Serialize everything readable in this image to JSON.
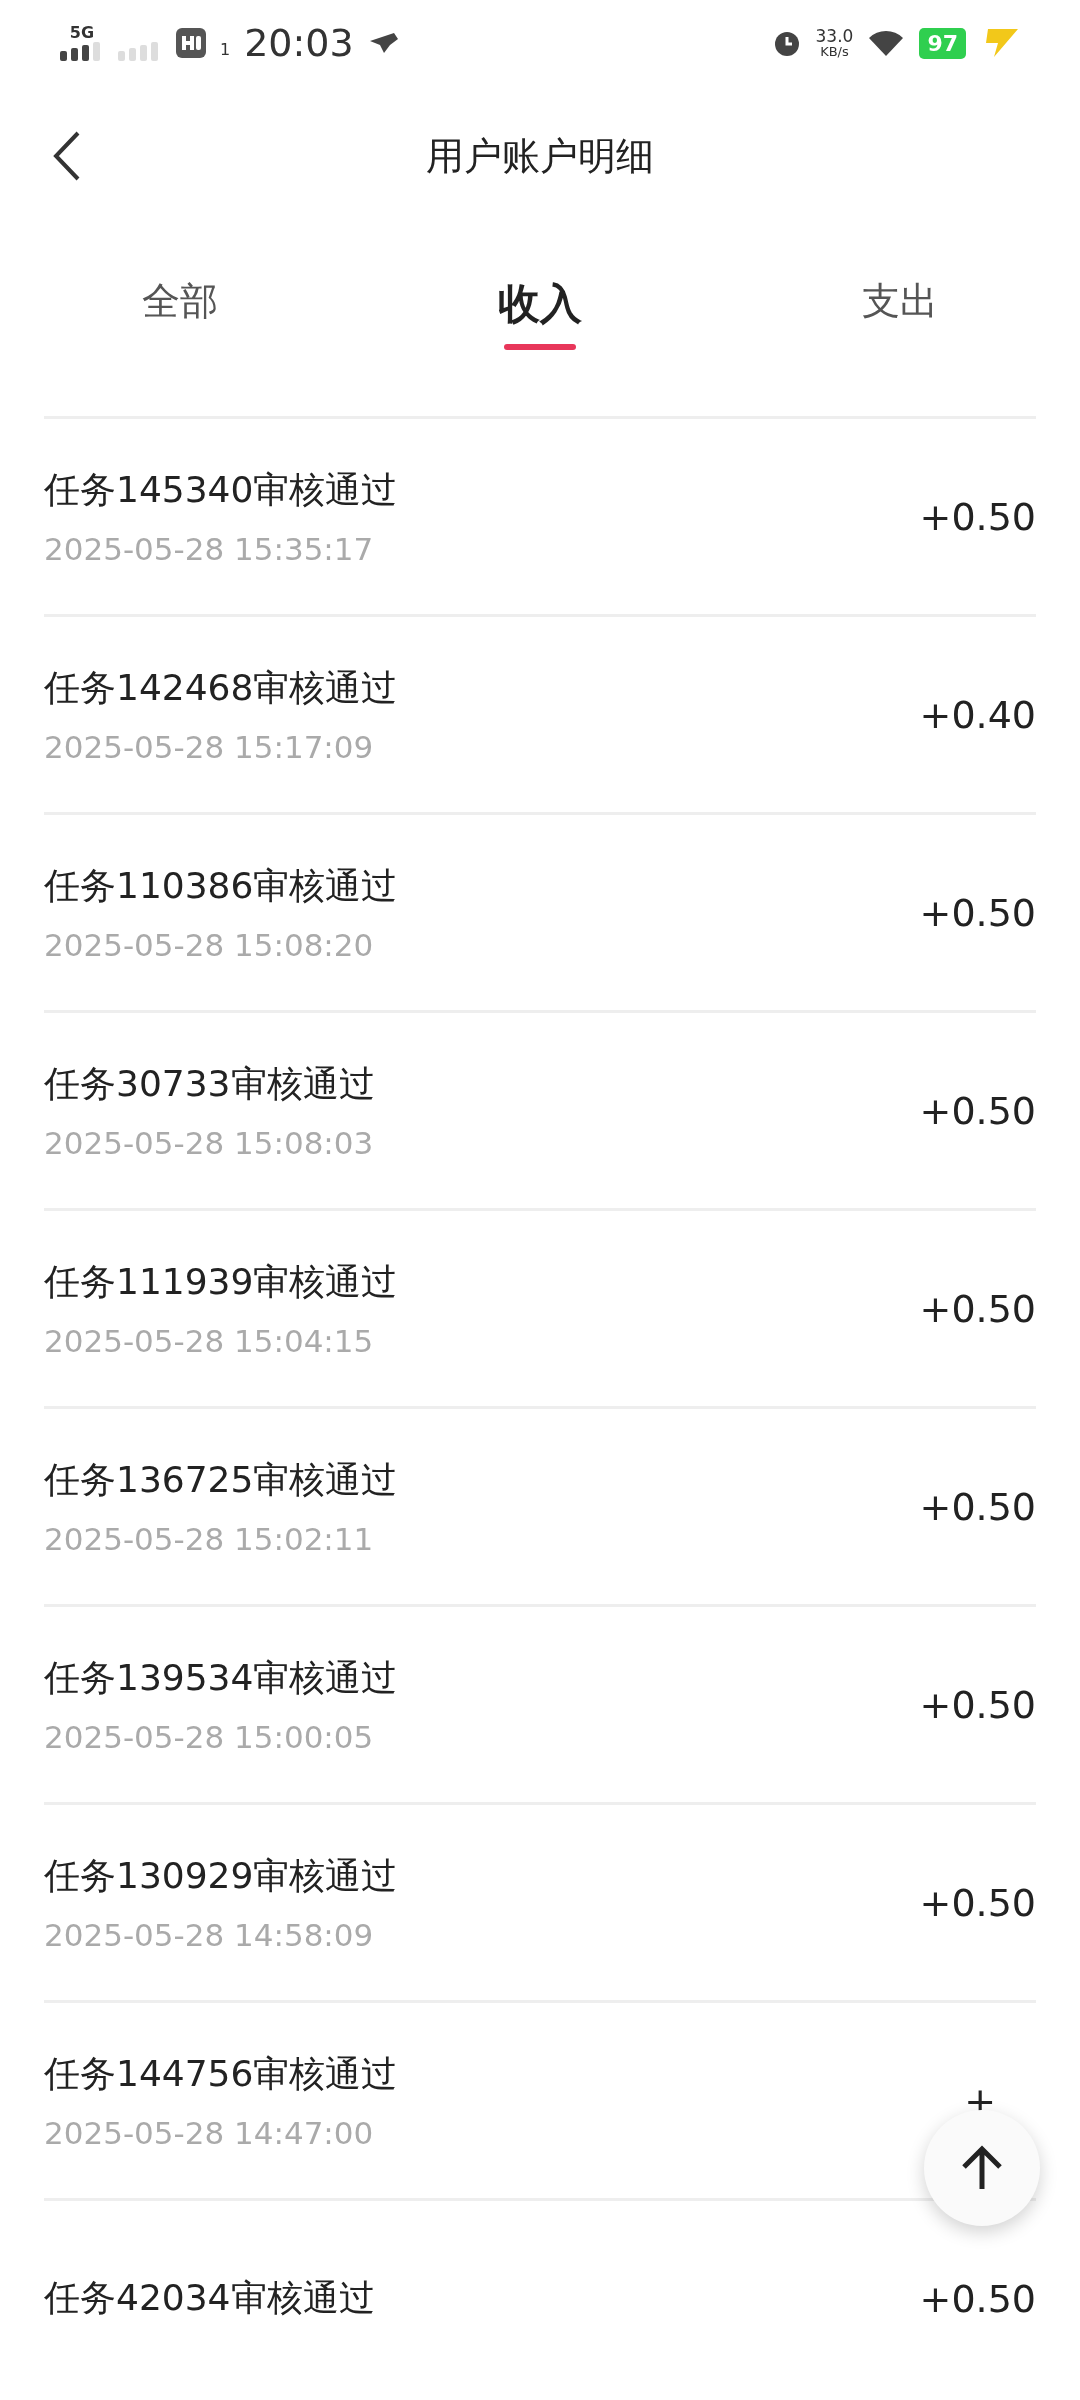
{
  "status_bar": {
    "network": "5G",
    "sim": "1",
    "time": "20:03",
    "speed": "33.0",
    "speed_unit": "KB/s",
    "battery": "97"
  },
  "header": {
    "title": "用户账户明细"
  },
  "tabs": [
    {
      "label": "全部",
      "selected": false
    },
    {
      "label": "收入",
      "selected": true
    },
    {
      "label": "支出",
      "selected": false
    }
  ],
  "records": [
    {
      "title": "任务145340审核通过",
      "time": "2025-05-28 15:35:17",
      "amount": "+0.50"
    },
    {
      "title": "任务142468审核通过",
      "time": "2025-05-28 15:17:09",
      "amount": "+0.40"
    },
    {
      "title": "任务110386审核通过",
      "time": "2025-05-28 15:08:20",
      "amount": "+0.50"
    },
    {
      "title": "任务30733审核通过",
      "time": "2025-05-28 15:08:03",
      "amount": "+0.50"
    },
    {
      "title": "任务111939审核通过",
      "time": "2025-05-28 15:04:15",
      "amount": "+0.50"
    },
    {
      "title": "任务136725审核通过",
      "time": "2025-05-28 15:02:11",
      "amount": "+0.50"
    },
    {
      "title": "任务139534审核通过",
      "time": "2025-05-28 15:00:05",
      "amount": "+0.50"
    },
    {
      "title": "任务130929审核通过",
      "time": "2025-05-28 14:58:09",
      "amount": "+0.50"
    },
    {
      "title": "任务144756审核通过",
      "time": "2025-05-28 14:47:00",
      "amount": "+"
    },
    {
      "title": "任务42034审核通过",
      "amount": "+0.50"
    }
  ]
}
